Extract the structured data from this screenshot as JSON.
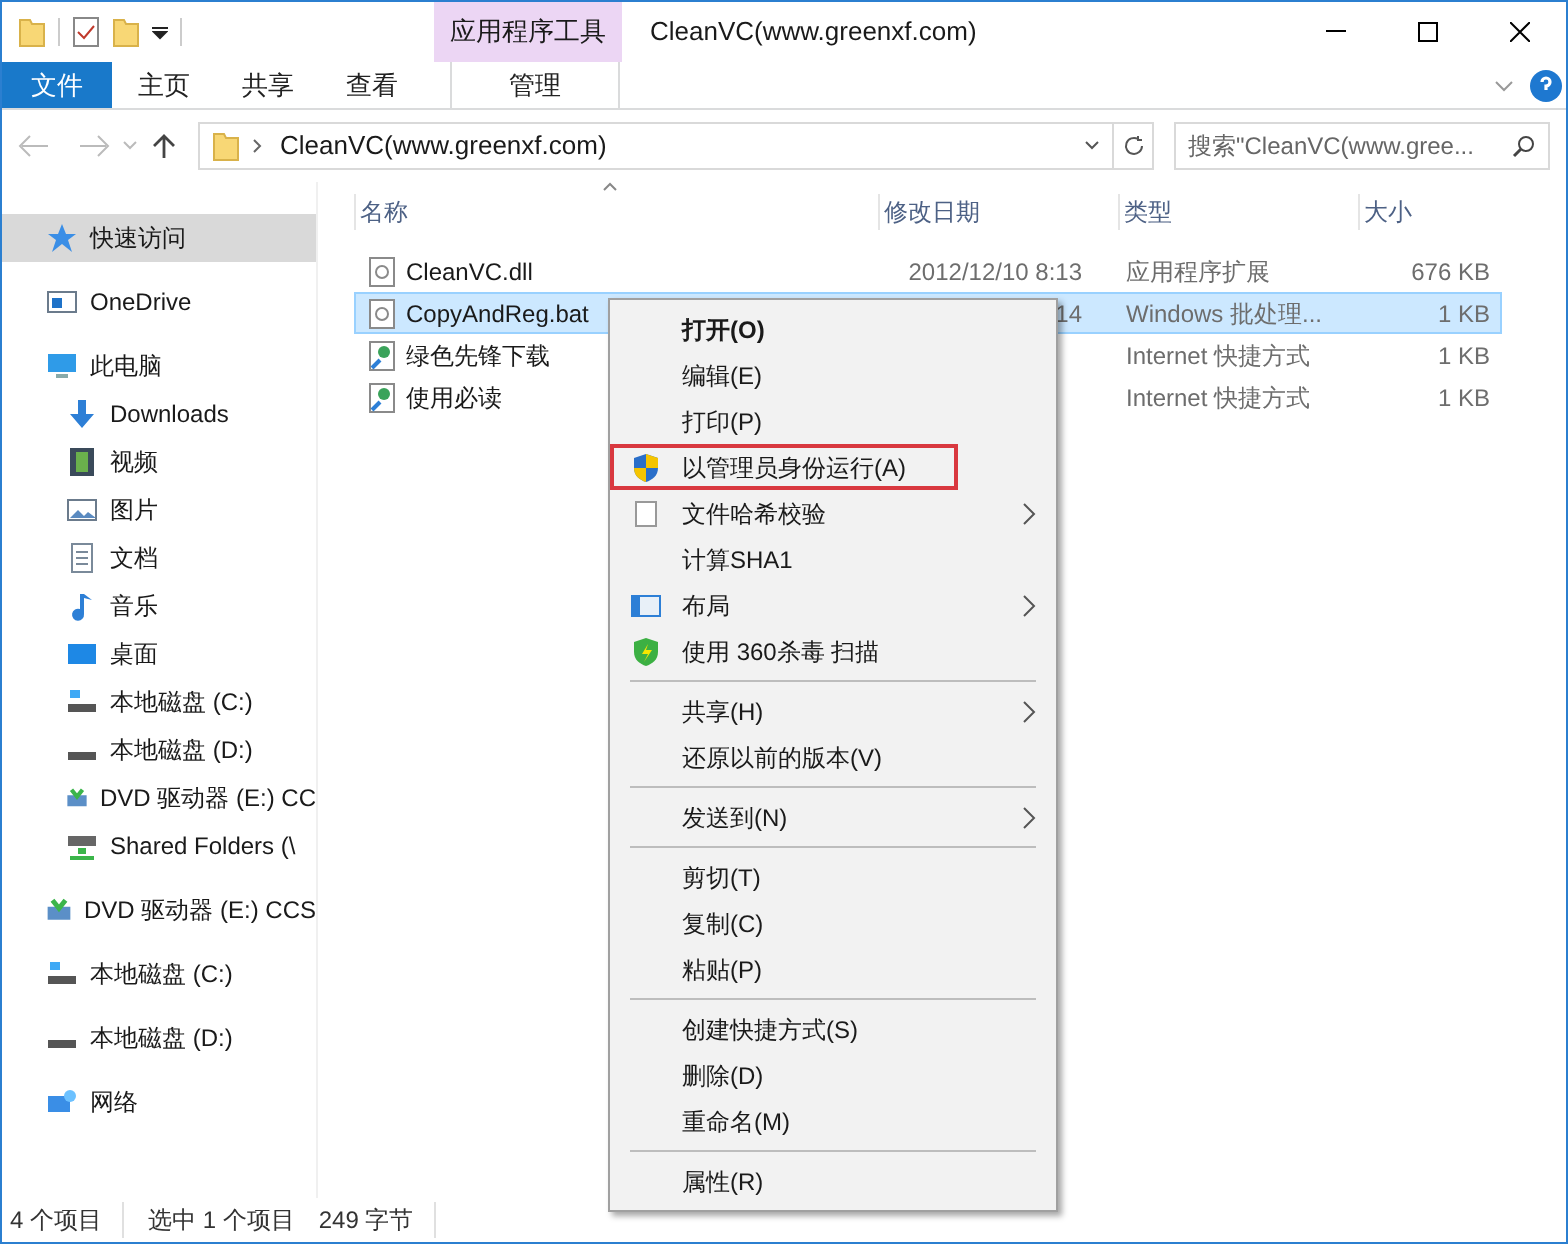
{
  "window": {
    "title": "CleanVC(www.greenxf.com)",
    "context_tab": "应用程序工具"
  },
  "ribbon_tabs": [
    {
      "label": "文件",
      "selected": true,
      "kind": "file"
    },
    {
      "label": "主页",
      "selected": false,
      "kind": "tab"
    },
    {
      "label": "共享",
      "selected": false,
      "kind": "tab"
    },
    {
      "label": "查看",
      "selected": false,
      "kind": "tab"
    },
    {
      "label": "管理",
      "selected": false,
      "kind": "context"
    }
  ],
  "address": {
    "path": "CleanVC(www.greenxf.com)",
    "search_placeholder": "搜索\"CleanVC(www.gree..."
  },
  "sidebar": {
    "items": [
      {
        "label": "快速访问",
        "kind": "star",
        "selected": true
      },
      {
        "label": "OneDrive",
        "kind": "cloud",
        "selected": false
      },
      {
        "label": "此电脑",
        "kind": "pc",
        "selected": false,
        "children": [
          {
            "label": "Downloads",
            "kind": "download",
            "selected": false
          },
          {
            "label": "视频",
            "kind": "video",
            "selected": false
          },
          {
            "label": "图片",
            "kind": "picture",
            "selected": false
          },
          {
            "label": "文档",
            "kind": "doc",
            "selected": false
          },
          {
            "label": "音乐",
            "kind": "music",
            "selected": false
          },
          {
            "label": "桌面",
            "kind": "desktop",
            "selected": false
          },
          {
            "label": "本地磁盘 (C:)",
            "kind": "sysdrive",
            "selected": false
          },
          {
            "label": "本地磁盘 (D:)",
            "kind": "drive",
            "selected": false
          },
          {
            "label": "DVD 驱动器 (E:) CC",
            "kind": "dvd",
            "selected": false
          },
          {
            "label": "Shared Folders (\\",
            "kind": "share",
            "selected": false
          }
        ]
      },
      {
        "label": "DVD 驱动器 (E:) CCS",
        "kind": "dvd",
        "selected": false
      },
      {
        "label": "本地磁盘 (C:)",
        "kind": "sysdrive",
        "selected": false
      },
      {
        "label": "本地磁盘 (D:)",
        "kind": "drive",
        "selected": false
      },
      {
        "label": "网络",
        "kind": "network",
        "selected": false
      }
    ]
  },
  "table": {
    "columns": [
      "名称",
      "修改日期",
      "类型",
      "大小"
    ],
    "rows": [
      {
        "name": "CleanVC.dll",
        "kind": "dll",
        "date": "2012/12/10 8:13",
        "type": "应用程序扩展",
        "size": "676 KB",
        "selected": false
      },
      {
        "name": "CopyAndReg.bat",
        "kind": "bat",
        "date": "14",
        "type": "Windows 批处理...",
        "size": "1 KB",
        "selected": true
      },
      {
        "name": "绿色先锋下载",
        "kind": "url",
        "type": "Internet 快捷方式",
        "size": "1 KB",
        "selected": false
      },
      {
        "name": "使用必读",
        "kind": "url",
        "type": "Internet 快捷方式",
        "size": "1 KB",
        "selected": false
      }
    ]
  },
  "context_menu": {
    "groups": [
      [
        {
          "label": "打开(O)",
          "bold": true
        },
        {
          "label": "编辑(E)"
        },
        {
          "label": "打印(P)"
        },
        {
          "label": "以管理员身份运行(A)",
          "kind": "uac",
          "outlined": true
        },
        {
          "label": "文件哈希校验",
          "kind": "blank",
          "submenu": true
        },
        {
          "label": "计算SHA1"
        },
        {
          "label": "布局",
          "kind": "layout",
          "submenu": true
        },
        {
          "label": "使用 360杀毒 扫描",
          "kind": "shield360"
        }
      ],
      [
        {
          "label": "共享(H)",
          "submenu": true
        },
        {
          "label": "还原以前的版本(V)"
        }
      ],
      [
        {
          "label": "发送到(N)",
          "submenu": true
        }
      ],
      [
        {
          "label": "剪切(T)"
        },
        {
          "label": "复制(C)"
        },
        {
          "label": "粘贴(P)"
        }
      ],
      [
        {
          "label": "创建快捷方式(S)"
        },
        {
          "label": "删除(D)"
        },
        {
          "label": "重命名(M)"
        }
      ],
      [
        {
          "label": "属性(R)"
        }
      ]
    ]
  },
  "status_bar": {
    "count": "4 个项目",
    "selection": "选中 1 个项目",
    "size": "249 字节"
  }
}
